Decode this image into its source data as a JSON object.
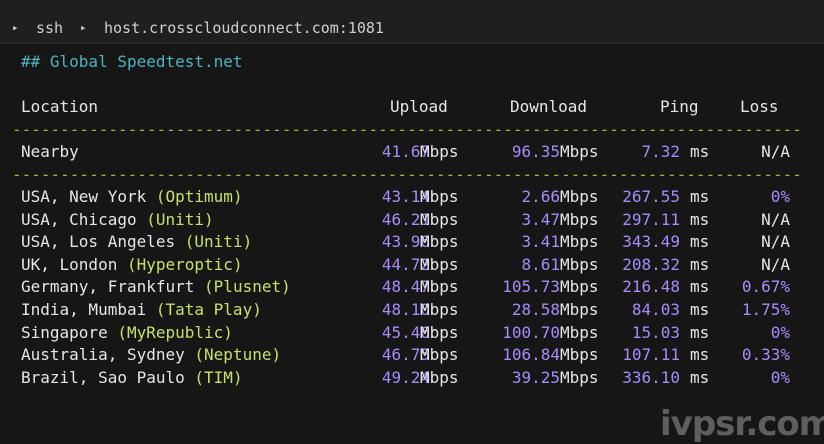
{
  "titlebar": {
    "arrow1": "▸",
    "app": "ssh",
    "arrow2": "▸",
    "host": "host.crosscloudconnect.com:1081"
  },
  "heading": "## Global Speedtest.net",
  "columns": {
    "location": "Location",
    "upload": "Upload",
    "download": "Download",
    "ping": "Ping",
    "loss": "Loss"
  },
  "divider": "----------------------------------------------------------------------------------------------------",
  "nearby": {
    "location": "Nearby",
    "upload": "41.67",
    "upload_unit": "Mbps",
    "download": "96.35",
    "download_unit": "Mbps",
    "ping": "7.32",
    "ping_unit": "ms",
    "loss": "N/A"
  },
  "rows": [
    {
      "city": "USA, New York ",
      "open": "(",
      "isp": "Optimum",
      "close": ")",
      "upload": "43.14",
      "upload_unit": "Mbps",
      "download": "2.66",
      "download_unit": "Mbps",
      "ping": "267.55",
      "ping_unit": "ms",
      "loss": "0%"
    },
    {
      "city": "USA, Chicago ",
      "open": "(",
      "isp": "Uniti",
      "close": ")",
      "upload": "46.21",
      "upload_unit": "Mbps",
      "download": "3.47",
      "download_unit": "Mbps",
      "ping": "297.11",
      "ping_unit": "ms",
      "loss": "N/A"
    },
    {
      "city": "USA, Los Angeles ",
      "open": "(",
      "isp": "Uniti",
      "close": ")",
      "upload": "43.96",
      "upload_unit": "Mbps",
      "download": "3.41",
      "download_unit": "Mbps",
      "ping": "343.49",
      "ping_unit": "ms",
      "loss": "N/A"
    },
    {
      "city": "UK, London ",
      "open": "(",
      "isp": "Hyperoptic",
      "close": ")",
      "upload": "44.72",
      "upload_unit": "Mbps",
      "download": "8.61",
      "download_unit": "Mbps",
      "ping": "208.32",
      "ping_unit": "ms",
      "loss": "N/A"
    },
    {
      "city": "Germany, Frankfurt ",
      "open": "(",
      "isp": "Plusnet",
      "close": ")",
      "upload": "48.47",
      "upload_unit": "Mbps",
      "download": "105.73",
      "download_unit": "Mbps",
      "ping": "216.48",
      "ping_unit": "ms",
      "loss": "0.67%"
    },
    {
      "city": "India, Mumbai ",
      "open": "(",
      "isp": "Tata Play",
      "close": ")",
      "upload": "48.10",
      "upload_unit": "Mbps",
      "download": "28.58",
      "download_unit": "Mbps",
      "ping": "84.03",
      "ping_unit": "ms",
      "loss": "1.75%"
    },
    {
      "city": "Singapore ",
      "open": "(",
      "isp": "MyRepublic",
      "close": ")",
      "upload": "45.46",
      "upload_unit": "Mbps",
      "download": "100.70",
      "download_unit": "Mbps",
      "ping": "15.03",
      "ping_unit": "ms",
      "loss": "0%"
    },
    {
      "city": "Australia, Sydney ",
      "open": "(",
      "isp": "Neptune",
      "close": ")",
      "upload": "46.75",
      "upload_unit": "Mbps",
      "download": "106.84",
      "download_unit": "Mbps",
      "ping": "107.11",
      "ping_unit": "ms",
      "loss": "0.33%"
    },
    {
      "city": "Brazil, Sao Paulo ",
      "open": "(",
      "isp": "TIM",
      "close": ")",
      "upload": "49.24",
      "upload_unit": "Mbps",
      "download": "39.25",
      "download_unit": "Mbps",
      "ping": "336.10",
      "ping_unit": "ms",
      "loss": "0%"
    }
  ],
  "watermark": "ivpsr.com",
  "colors": {
    "background": "#161616",
    "titlebar": "#1f1f1f",
    "heading": "#4fb3bf",
    "number": "#a78bfa",
    "isp": "#c8e06a",
    "divider": "#9ab832"
  }
}
